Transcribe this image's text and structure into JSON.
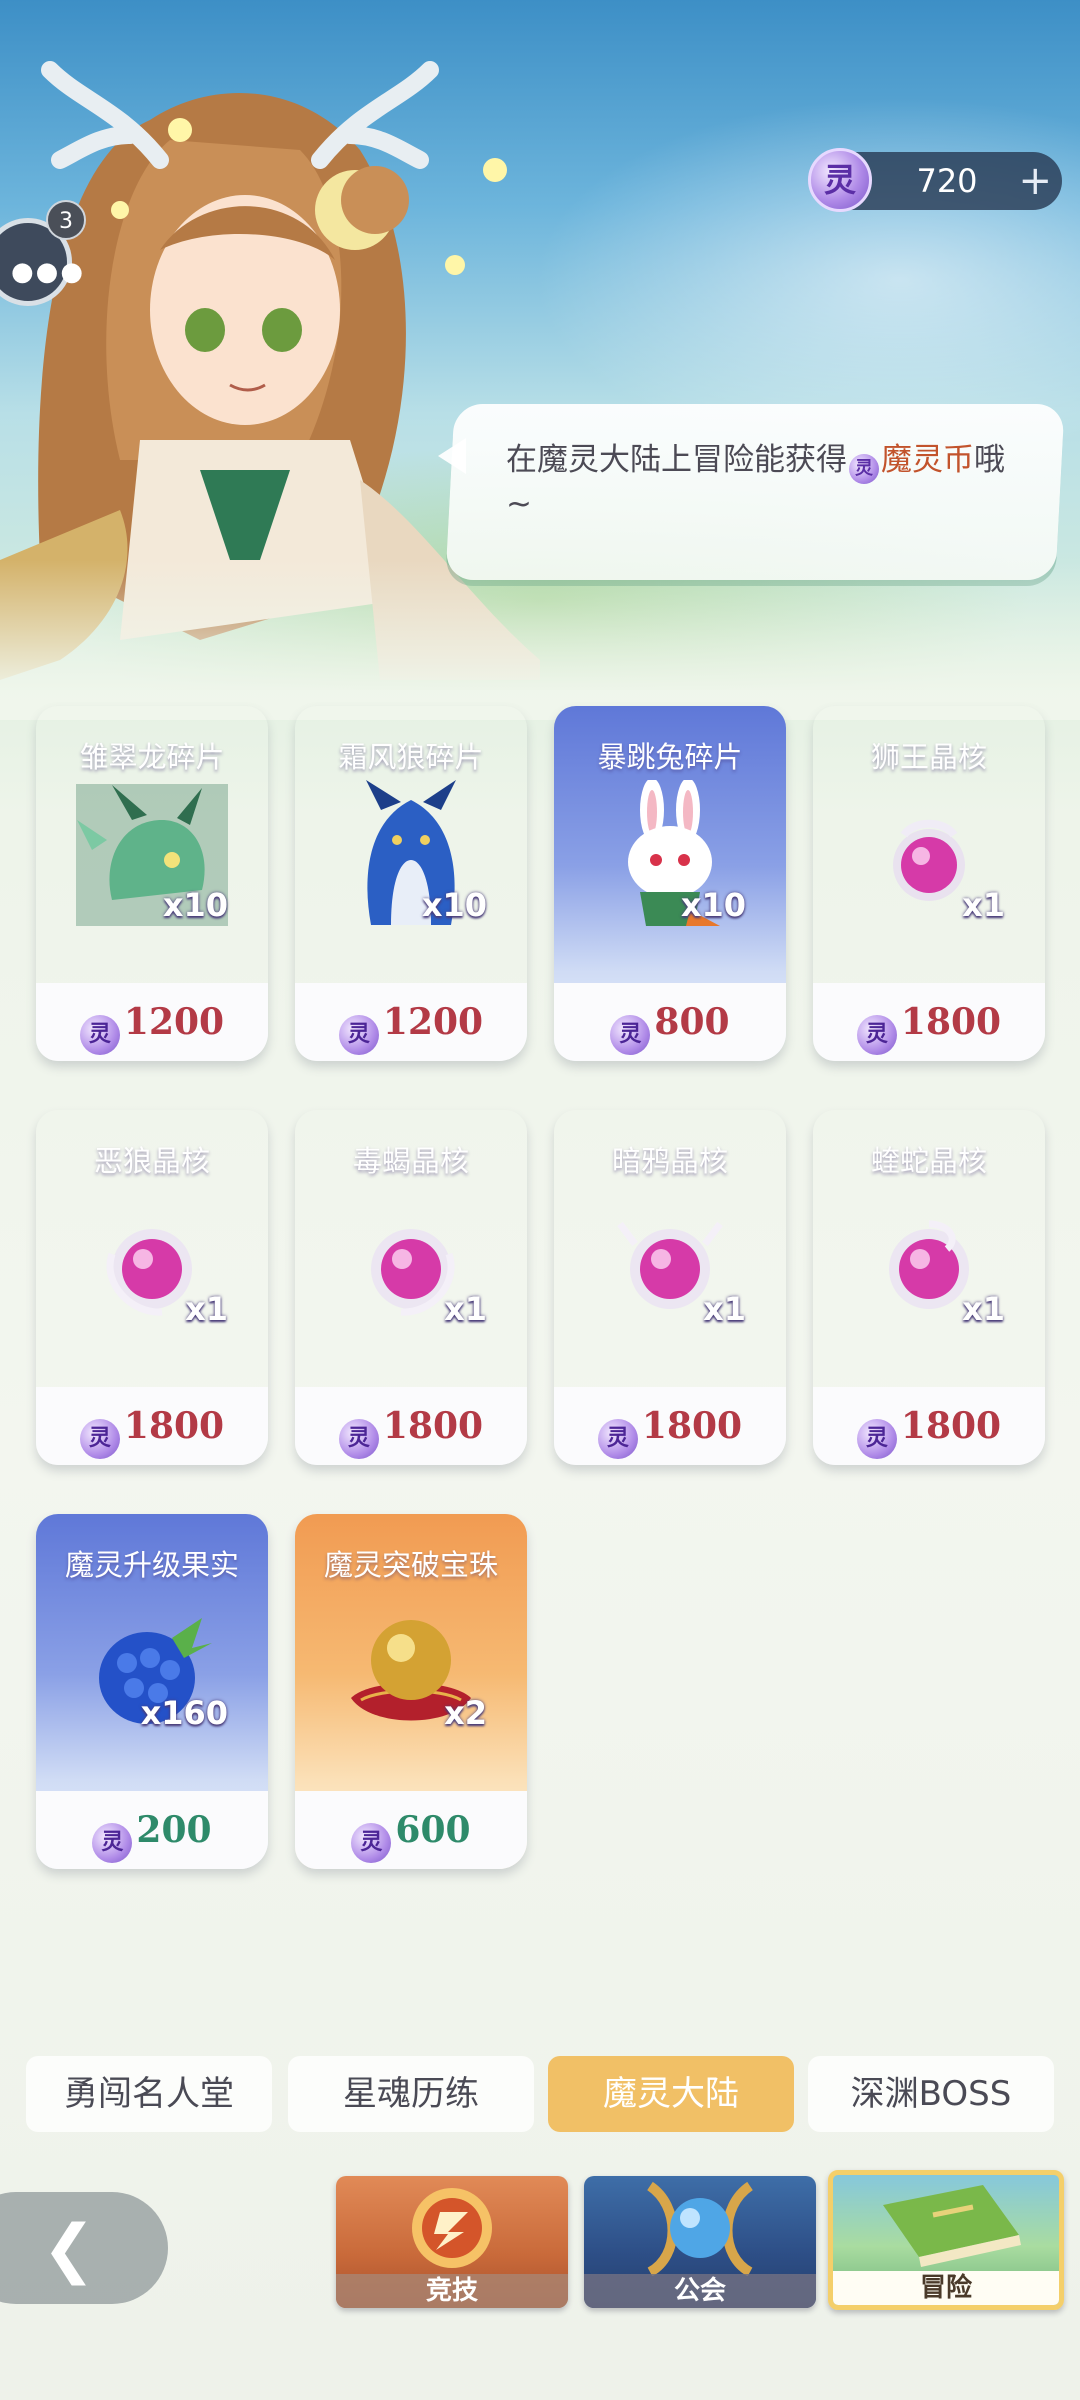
{
  "currency": {
    "icon": "spirit-coin-icon",
    "glyph": "灵",
    "amount": "720",
    "plus": "+"
  },
  "chat": {
    "badge": "3"
  },
  "speech": {
    "before": "在魔灵大陆上冒险能获得",
    "coin_glyph": "灵",
    "highlight": "魔灵币",
    "after": "哦~"
  },
  "shop": {
    "coin_glyph": "灵",
    "items": [
      {
        "name": "雏翠龙碎片",
        "qty": "x10",
        "price": "1200",
        "style": "purple",
        "art": "green-dragon"
      },
      {
        "name": "霜风狼碎片",
        "qty": "x10",
        "price": "1200",
        "style": "purple",
        "art": "blue-wolf"
      },
      {
        "name": "暴跳兔碎片",
        "qty": "x10",
        "price": "800",
        "style": "blue",
        "art": "white-rabbit"
      },
      {
        "name": "狮王晶核",
        "qty": "x1",
        "price": "1800",
        "style": "purple",
        "art": "crystal-core"
      },
      {
        "name": "恶狼晶核",
        "qty": "x1",
        "price": "1800",
        "style": "purple",
        "art": "crystal-core"
      },
      {
        "name": "毒蝎晶核",
        "qty": "x1",
        "price": "1800",
        "style": "purple",
        "art": "crystal-core"
      },
      {
        "name": "暗鸦晶核",
        "qty": "x1",
        "price": "1800",
        "style": "purple",
        "art": "crystal-core"
      },
      {
        "name": "蝰蛇晶核",
        "qty": "x1",
        "price": "1800",
        "style": "purple",
        "art": "crystal-core"
      },
      {
        "name": "魔灵升级果实",
        "qty": "x160",
        "price": "200",
        "style": "blue",
        "art": "blue-berry"
      },
      {
        "name": "魔灵突破宝珠",
        "qty": "x2",
        "price": "600",
        "style": "orange",
        "art": "golden-orb"
      }
    ]
  },
  "tabs": [
    {
      "label": "勇闯名人堂",
      "active": false
    },
    {
      "label": "星魂历练",
      "active": false
    },
    {
      "label": "魔灵大陆",
      "active": true
    },
    {
      "label": "深渊BOSS",
      "active": false
    }
  ],
  "bottom_nav": {
    "arena": "竞技",
    "guild": "公会",
    "adventure": "冒险"
  },
  "colors": {
    "price_red": "#b33a46",
    "price_green": "#2e8a6a",
    "active_tab": "#f1c066",
    "speech_highlight": "#c2532c"
  }
}
